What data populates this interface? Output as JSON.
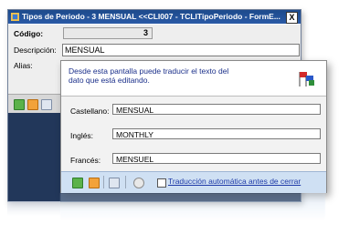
{
  "window": {
    "title": "Tipos de Periodo - 3  MENSUAL  <<CLI007 - TCLITipoPeriodo - FormE...",
    "close_label": "X"
  },
  "form": {
    "codigo_label": "Código:",
    "codigo_value": "3",
    "descripcion_label": "Descripción:",
    "descripcion_value": "MENSUAL",
    "alias_label": "Alias:"
  },
  "dialog": {
    "info_text": "Desde esta pantalla puede traducir el texto del dato que está editando.",
    "fields": [
      {
        "label": "Castellano:",
        "value": "MENSUAL"
      },
      {
        "label": "Inglés:",
        "value": "MONTHLY"
      },
      {
        "label": "Francés:",
        "value": "MENSUEL"
      }
    ],
    "auto_translate_label": "Traducción automática antes de cerrar",
    "auto_translate_checked": false
  },
  "icons": {
    "ok": "check-icon",
    "cancel": "cancel-icon",
    "copy": "copy-icon",
    "help": "help-icon",
    "flags": "flags-icon"
  },
  "colors": {
    "titlebar": "#1d4a8c",
    "navy_background": "#22375a",
    "footer": "#cfe0f3",
    "info_text": "#1a2f8a"
  }
}
